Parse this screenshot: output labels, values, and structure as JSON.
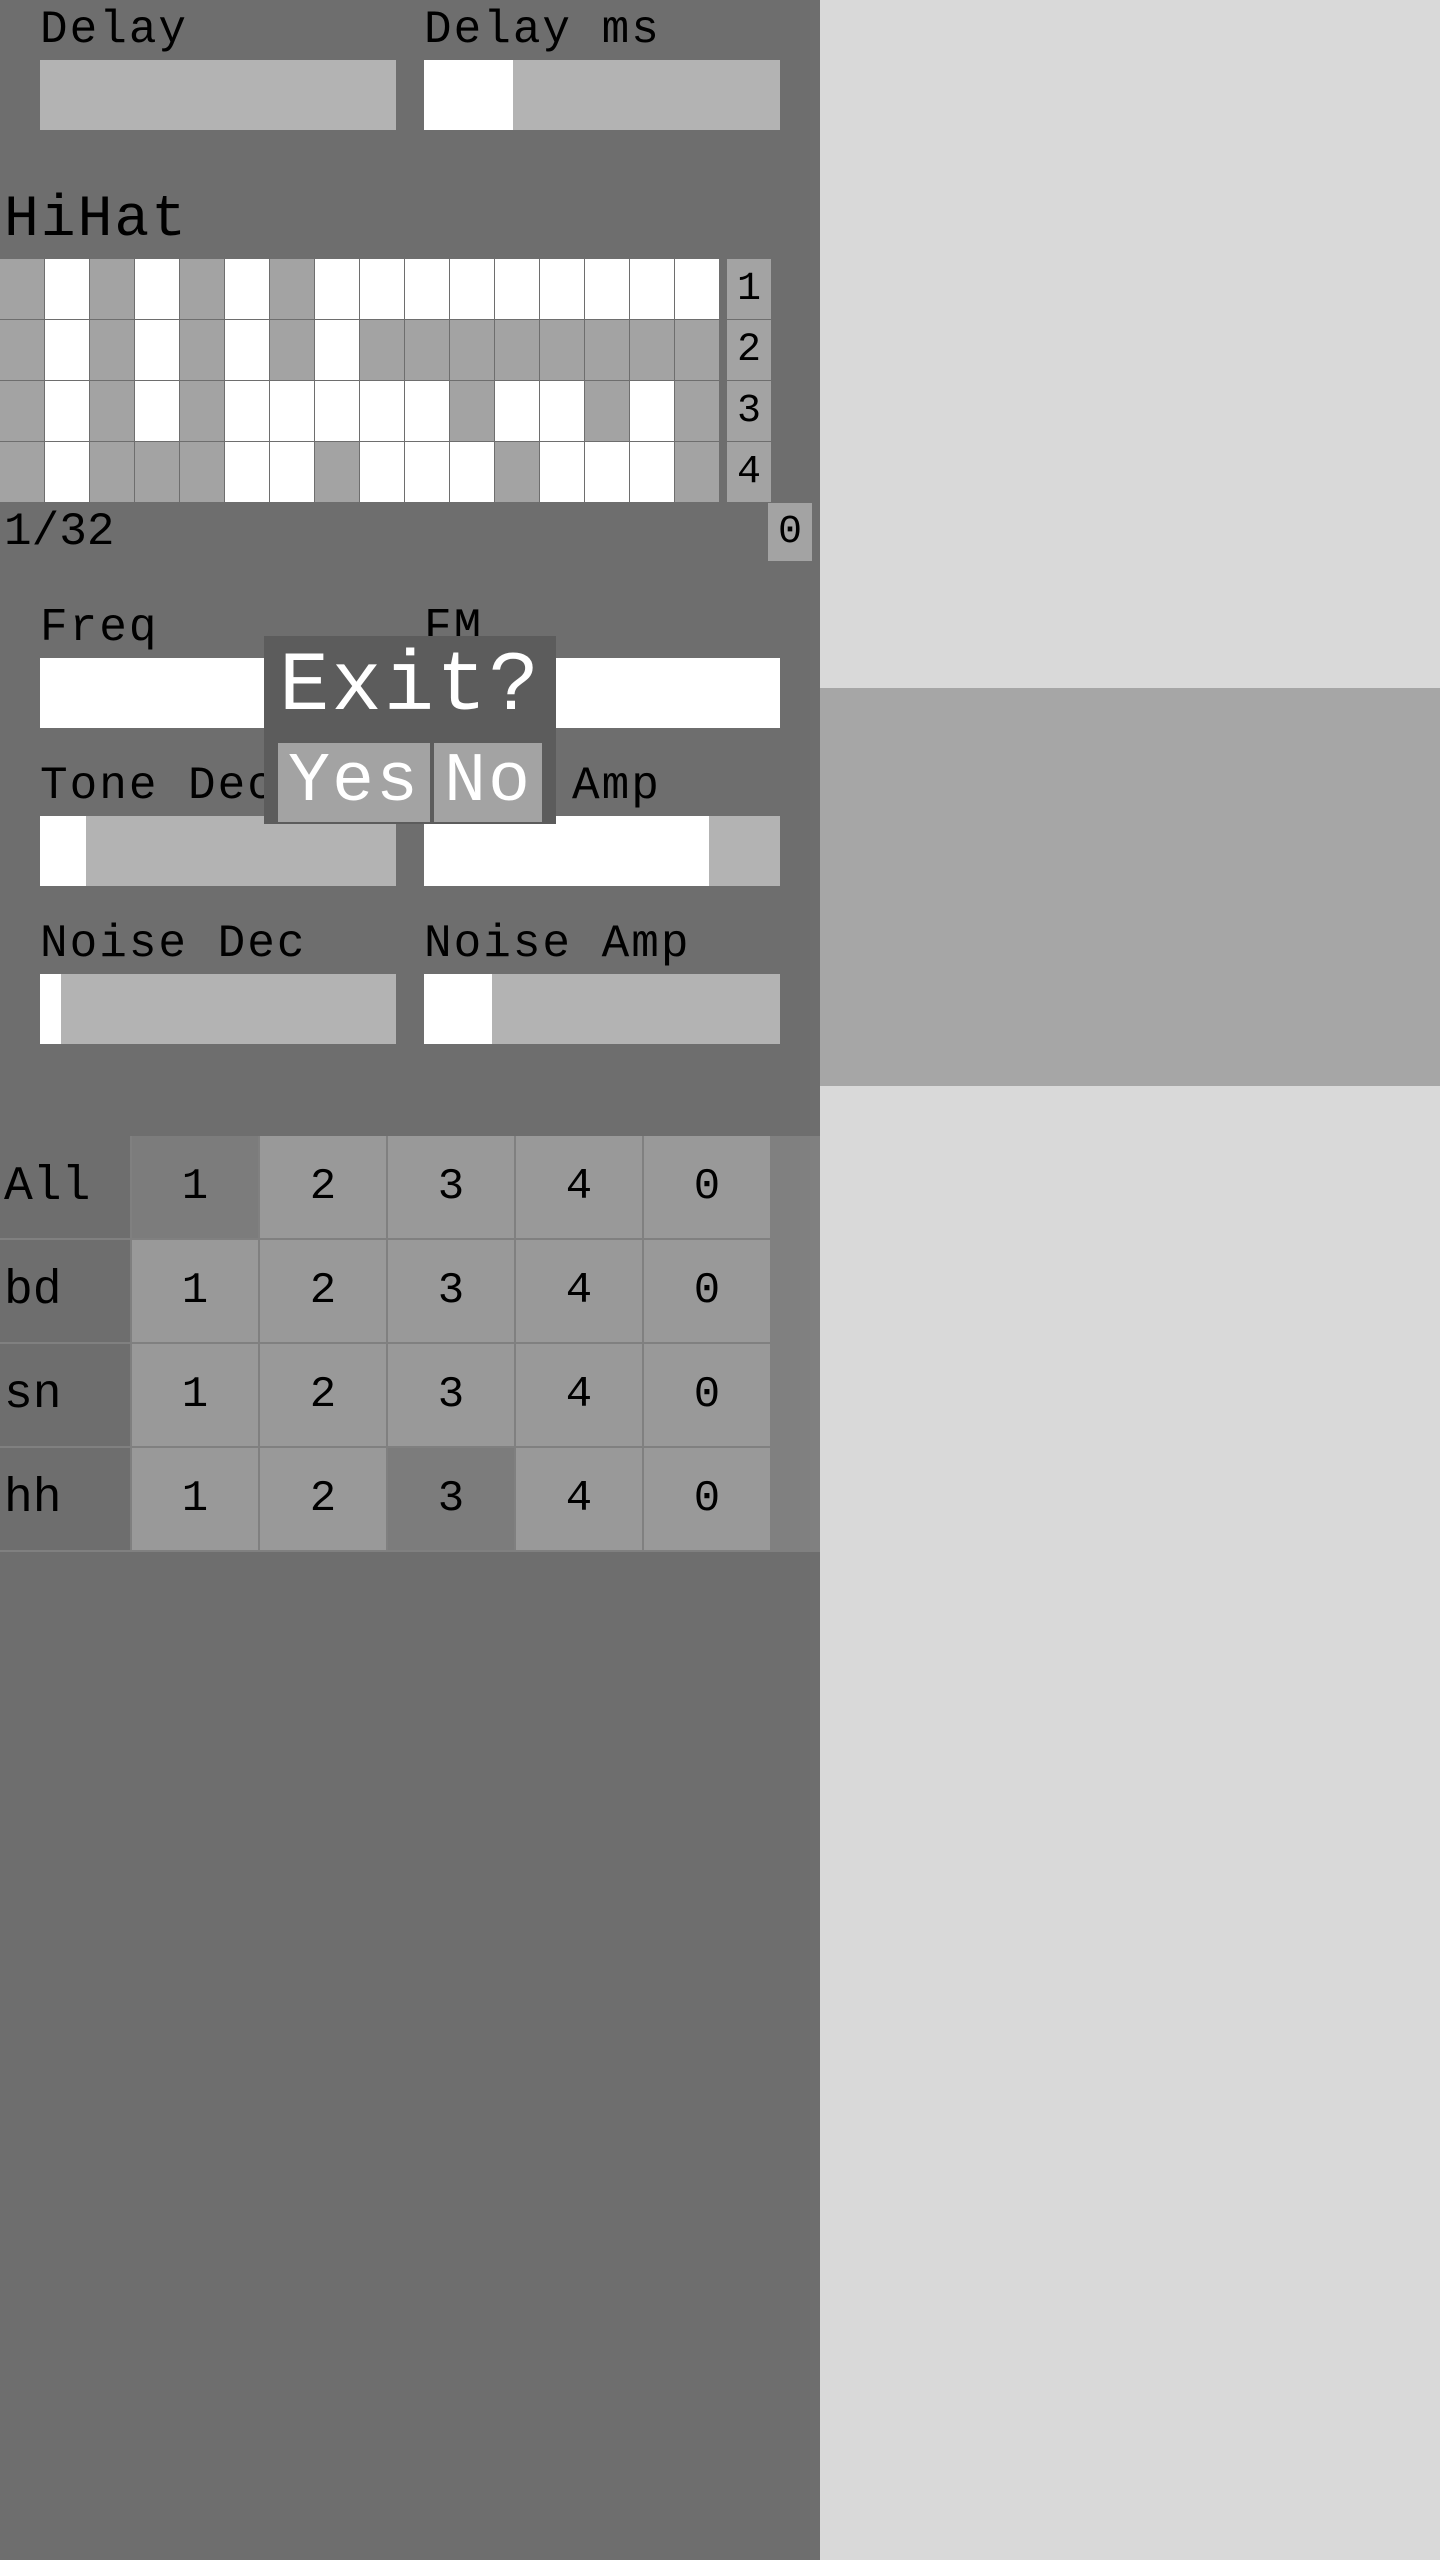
{
  "top": {
    "delay": {
      "label": "Delay",
      "fill": 0
    },
    "delay_ms": {
      "label": "Delay ms",
      "fill": 0.25
    }
  },
  "hihat": {
    "label": "HiHat",
    "rows": [
      {
        "tag": "1",
        "cells": [
          0,
          1,
          0,
          1,
          0,
          1,
          0,
          1,
          1,
          1,
          1,
          1,
          1,
          1,
          1,
          1
        ]
      },
      {
        "tag": "2",
        "cells": [
          0,
          1,
          0,
          1,
          0,
          1,
          0,
          1,
          0,
          0,
          0,
          0,
          0,
          0,
          0,
          0
        ]
      },
      {
        "tag": "3",
        "cells": [
          0,
          1,
          0,
          1,
          0,
          1,
          1,
          1,
          1,
          1,
          0,
          1,
          1,
          0,
          1,
          0
        ]
      },
      {
        "tag": "4",
        "cells": [
          0,
          1,
          0,
          0,
          0,
          1,
          1,
          0,
          1,
          1,
          1,
          0,
          1,
          1,
          1,
          0
        ]
      }
    ],
    "sub_label": "1/32",
    "sub_tag": "0",
    "params": {
      "freq": {
        "label": "Freq",
        "fill": 0.94
      },
      "fm": {
        "label": "FM",
        "fill": 1.0
      },
      "tone_dec": {
        "label": "Tone Dec",
        "fill": 0.13
      },
      "tone_amp": {
        "label": "Tone Amp",
        "fill": 0.8,
        "obscured": true
      },
      "noise_dec": {
        "label": "Noise Dec",
        "fill": 0.06
      },
      "noise_amp": {
        "label": "Noise Amp",
        "fill": 0.19
      }
    }
  },
  "patterns": {
    "cols": [
      "1",
      "2",
      "3",
      "4",
      "0"
    ],
    "rows": [
      {
        "label": "All",
        "sel": 0
      },
      {
        "label": "bd",
        "sel": -1
      },
      {
        "label": "sn",
        "sel": -1
      },
      {
        "label": "hh",
        "sel": 2
      }
    ]
  },
  "modal": {
    "title": "Exit?",
    "yes": "Yes",
    "no": "No"
  }
}
